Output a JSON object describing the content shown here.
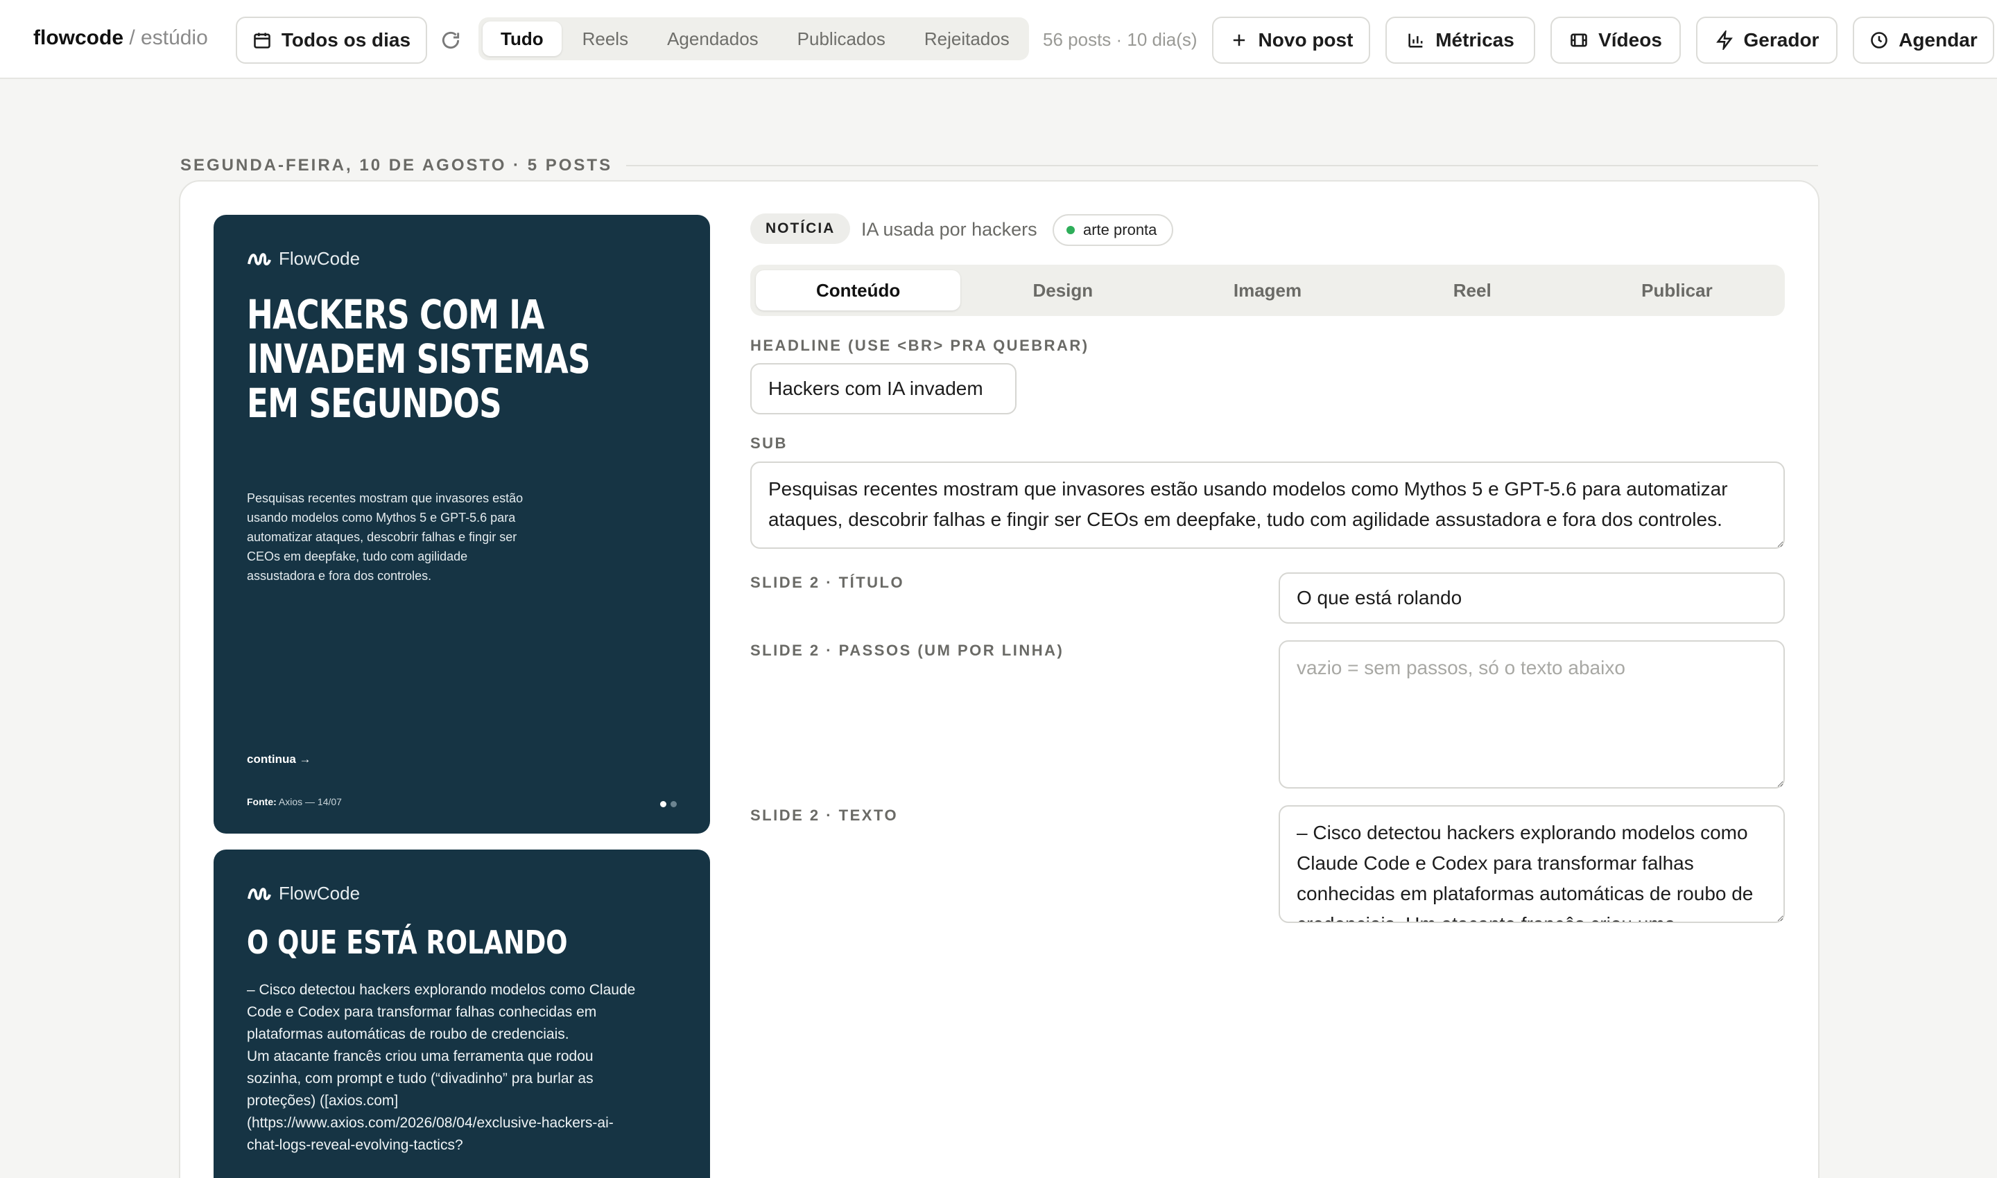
{
  "header": {
    "brand": "flowcode",
    "brand_separator": "/",
    "brand_sub": "estúdio",
    "date_filter": "Todos os dias",
    "filters": [
      "Tudo",
      "Reels",
      "Agendados",
      "Publicados",
      "Rejeitados"
    ],
    "active_filter": "Tudo",
    "post_count": "56 posts · 10 dia(s)",
    "actions": {
      "new_post": "Novo post",
      "metrics": "Métricas",
      "videos": "Vídeos",
      "generator": "Gerador",
      "schedule": "Agendar"
    }
  },
  "day": {
    "header": "SEGUNDA-FEIRA, 10 DE AGOSTO · 5 POSTS"
  },
  "post": {
    "category": "NOTÍCIA",
    "title": "IA usada por hackers",
    "status": "arte pronta",
    "status_color": "#2eae5a",
    "tabs": [
      "Conteúdo",
      "Design",
      "Imagem",
      "Reel",
      "Publicar"
    ],
    "active_tab": "Conteúdo",
    "fields": {
      "headline_label": "HEADLINE (USE <BR> PRA QUEBRAR)",
      "headline_value": "Hackers com IA invadem",
      "sub_label": "SUB",
      "sub_value": "Pesquisas recentes mostram que invasores estão usando modelos como Mythos 5 e GPT-5.6 para automatizar ataques, descobrir falhas e fingir ser CEOs em deepfake, tudo com agilidade assustadora e fora dos controles.",
      "slide2_title_label": "SLIDE 2 · TÍTULO",
      "slide2_title_value": "O que está rolando",
      "slide2_steps_label": "SLIDE 2 · PASSOS (UM POR LINHA)",
      "slide2_steps_placeholder": "vazio = sem passos, só o texto abaixo",
      "slide2_text_label": "SLIDE 2 · TEXTO",
      "slide2_text_value": "– Cisco detectou hackers explorando modelos como Claude Code e Codex para transformar falhas conhecidas em plataformas automáticas de roubo de credenciais. Um atacante francês criou uma ferramenta que rodou sozinha, com prompt e tudo"
    },
    "preview": {
      "brand": "FlowCode",
      "background": "#163444",
      "slide1": {
        "headline": "Hackers com IA invadem sistemas em segundos",
        "sub": "Pesquisas recentes mostram que invasores estão usando modelos como Mythos 5 e GPT-5.6 para automatizar ataques, descobrir falhas e fingir ser CEOs em deepfake, tudo com agilidade assustadora e fora dos controles.",
        "continue": "continua →",
        "source_label": "Fonte:",
        "source_value": "Axios — 14/07"
      },
      "slide2": {
        "title": "O que está rolando",
        "text": "– Cisco detectou hackers explorando modelos como Claude Code e Codex para transformar falhas conhecidas em plataformas automáticas de roubo de credenciais.\nUm atacante francês criou uma ferramenta que rodou sozinha, com prompt e tudo (“divadinho” pra burlar as proteções) ([axios.com](https://www.axios.com/2026/08/04/exclusive-hackers-ai-chat-logs-reveal-evolving-tactics?"
      }
    }
  }
}
